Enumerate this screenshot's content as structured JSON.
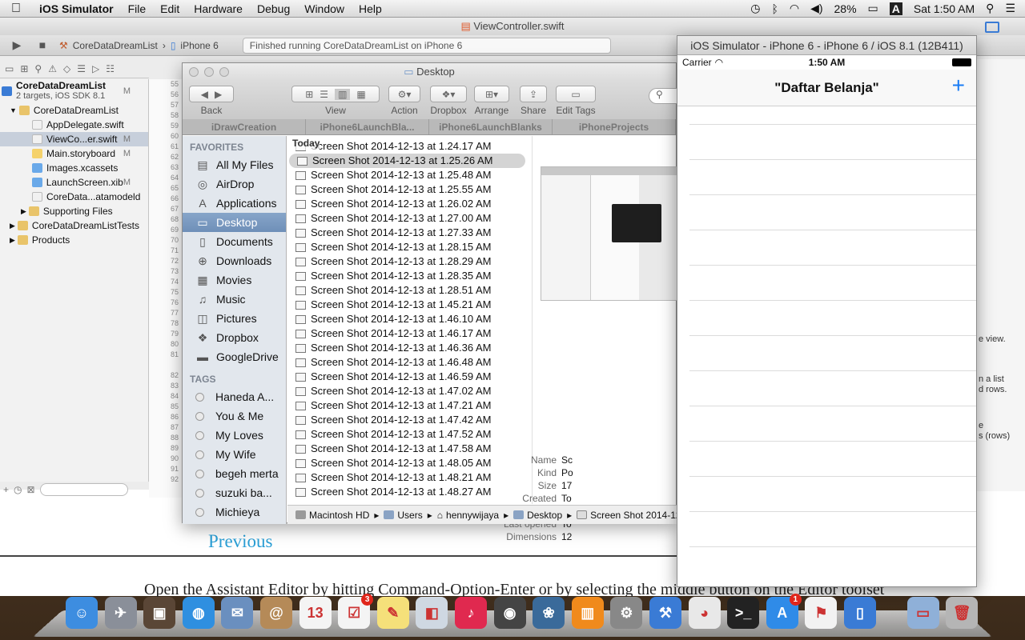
{
  "menubar": {
    "app_name": "iOS Simulator",
    "items": [
      "File",
      "Edit",
      "Hardware",
      "Debug",
      "Window",
      "Help"
    ],
    "battery": "28%",
    "input_source": "A",
    "clock": "Sat 1:50 AM"
  },
  "background_page": {
    "previous_link": "Previous",
    "instruction": "Open the Assistant Editor by hitting Command-Option-Enter or by selecting the middle button on the Editor toolset"
  },
  "xcode": {
    "title": "ViewController.swift",
    "scheme_project": "CoreDataDreamList",
    "scheme_device": "iPhone 6",
    "activity": "Finished running CoreDataDreamList on iPhone 6",
    "navigator": [
      {
        "label": "CoreDataDreamList",
        "sub": "2 targets, iOS SDK 8.1",
        "status": "M",
        "level": 0,
        "type": "project"
      },
      {
        "label": "CoreDataDreamList",
        "status": "",
        "level": 1,
        "type": "folder"
      },
      {
        "label": "AppDelegate.swift",
        "status": "",
        "level": 2,
        "type": "swift"
      },
      {
        "label": "ViewCo...er.swift",
        "status": "M",
        "level": 2,
        "type": "swift",
        "selected": true
      },
      {
        "label": "Main.storyboard",
        "status": "M",
        "level": 2,
        "type": "storyboard"
      },
      {
        "label": "Images.xcassets",
        "status": "",
        "level": 2,
        "type": "assets"
      },
      {
        "label": "LaunchScreen.xib",
        "status": "M",
        "level": 2,
        "type": "xib"
      },
      {
        "label": "CoreData...atamodeld",
        "status": "",
        "level": 2,
        "type": "model"
      },
      {
        "label": "Supporting Files",
        "status": "",
        "level": 2,
        "type": "folder"
      },
      {
        "label": "CoreDataDreamListTests",
        "status": "",
        "level": 1,
        "type": "folder"
      },
      {
        "label": "Products",
        "status": "",
        "level": 1,
        "type": "folder"
      }
    ],
    "line_numbers": [
      "55",
      "56",
      "57",
      "58",
      "59",
      "60",
      "61",
      "62",
      "63",
      "64",
      "65",
      "66",
      "67",
      "68",
      "69",
      "70",
      "71",
      "72",
      "73",
      "74",
      "75",
      "76",
      "77",
      "78",
      "79",
      "80",
      "81",
      "",
      "82",
      "83",
      "84",
      "85",
      "86",
      "87",
      "88",
      "89",
      "90",
      "91",
      "92"
    ],
    "right_snippets": [
      "e view.",
      "n a list",
      "d rows.",
      "e",
      "s (rows)"
    ]
  },
  "finder": {
    "title": "Desktop",
    "toolbar": {
      "back": "Back",
      "view": "View",
      "action": "Action",
      "dropbox": "Dropbox",
      "arrange": "Arrange",
      "share": "Share",
      "edit_tags": "Edit Tags"
    },
    "tabs": [
      "iDrawCreation",
      "iPhone6LaunchBla...",
      "iPhone6LaunchBlanks",
      "iPhoneProjects"
    ],
    "favorites_header": "FAVORITES",
    "favorites": [
      {
        "label": "All My Files",
        "icon": "all-files-icon",
        "glyph": "▤"
      },
      {
        "label": "AirDrop",
        "icon": "airdrop-icon",
        "glyph": "◎"
      },
      {
        "label": "Applications",
        "icon": "applications-icon",
        "glyph": "A"
      },
      {
        "label": "Desktop",
        "icon": "desktop-icon",
        "glyph": "▭",
        "selected": true
      },
      {
        "label": "Documents",
        "icon": "documents-icon",
        "glyph": "▯"
      },
      {
        "label": "Downloads",
        "icon": "downloads-icon",
        "glyph": "⊕"
      },
      {
        "label": "Movies",
        "icon": "movies-icon",
        "glyph": "▦"
      },
      {
        "label": "Music",
        "icon": "music-icon",
        "glyph": "♫"
      },
      {
        "label": "Pictures",
        "icon": "pictures-icon",
        "glyph": "◫"
      },
      {
        "label": "Dropbox",
        "icon": "dropbox-icon",
        "glyph": "❖"
      },
      {
        "label": "GoogleDrive",
        "icon": "folder-icon",
        "glyph": "▬"
      }
    ],
    "tags_header": "TAGS",
    "tags": [
      "Haneda A...",
      "You & Me",
      "My Loves",
      "My Wife",
      "begeh merta",
      "suzuki ba...",
      "Michieya"
    ],
    "list_header": "Today",
    "files": [
      "Screen Shot 2014-12-13 at 1.24.17 AM",
      "Screen Shot 2014-12-13 at 1.25.26 AM",
      "Screen Shot 2014-12-13 at 1.25.48 AM",
      "Screen Shot 2014-12-13 at 1.25.55 AM",
      "Screen Shot 2014-12-13 at 1.26.02 AM",
      "Screen Shot 2014-12-13 at 1.27.00 AM",
      "Screen Shot 2014-12-13 at 1.27.33 AM",
      "Screen Shot 2014-12-13 at 1.28.15 AM",
      "Screen Shot 2014-12-13 at 1.28.29 AM",
      "Screen Shot 2014-12-13 at 1.28.35 AM",
      "Screen Shot 2014-12-13 at 1.28.51 AM",
      "Screen Shot 2014-12-13 at 1.45.21 AM",
      "Screen Shot 2014-12-13 at 1.46.10 AM",
      "Screen Shot 2014-12-13 at 1.46.17 AM",
      "Screen Shot 2014-12-13 at 1.46.36 AM",
      "Screen Shot 2014-12-13 at 1.46.48 AM",
      "Screen Shot 2014-12-13 at 1.46.59 AM",
      "Screen Shot 2014-12-13 at 1.47.02 AM",
      "Screen Shot 2014-12-13 at 1.47.21 AM",
      "Screen Shot 2014-12-13 at 1.47.42 AM",
      "Screen Shot 2014-12-13 at 1.47.52 AM",
      "Screen Shot 2014-12-13 at 1.47.58 AM",
      "Screen Shot 2014-12-13 at 1.48.05 AM",
      "Screen Shot 2014-12-13 at 1.48.21 AM",
      "Screen Shot 2014-12-13 at 1.48.27 AM"
    ],
    "selected_file_index": 1,
    "preview_meta": [
      {
        "key": "Name",
        "value": "Sc"
      },
      {
        "key": "Kind",
        "value": "Po"
      },
      {
        "key": "Size",
        "value": "17"
      },
      {
        "key": "Created",
        "value": "To"
      },
      {
        "key": "Modified",
        "value": "To"
      },
      {
        "key": "Last opened",
        "value": "To"
      },
      {
        "key": "Dimensions",
        "value": "12"
      }
    ],
    "path": [
      "Macintosh HD",
      "Users",
      "hennywijaya",
      "Desktop",
      "Screen Shot 2014-12"
    ]
  },
  "simulator": {
    "title": "iOS Simulator - iPhone 6 - iPhone 6 / iOS 8.1 (12B411)",
    "carrier": "Carrier",
    "time": "1:50 AM",
    "nav_title": "\"Daftar Belanja\"",
    "add_button": "+",
    "row_count": 13
  },
  "dock": {
    "items": [
      {
        "name": "finder",
        "color": "#3d8de0",
        "glyph": "☺"
      },
      {
        "name": "launchpad",
        "color": "#8a8f99",
        "glyph": "✈"
      },
      {
        "name": "photo-booth",
        "color": "#5a4636",
        "glyph": "▣"
      },
      {
        "name": "safari",
        "color": "#2f8fe0",
        "glyph": "◍"
      },
      {
        "name": "mail",
        "color": "#6a8fbf",
        "glyph": "✉"
      },
      {
        "name": "contacts",
        "color": "#b58a58",
        "glyph": "@"
      },
      {
        "name": "calendar",
        "color": "#f4f4f4",
        "glyph": "13"
      },
      {
        "name": "reminders",
        "color": "#f4f4f4",
        "glyph": "☑",
        "badge": "3"
      },
      {
        "name": "notes",
        "color": "#f5e07a",
        "glyph": "✎"
      },
      {
        "name": "preview",
        "color": "#cfd8e2",
        "glyph": "◧"
      },
      {
        "name": "itunes",
        "color": "#e0294f",
        "glyph": "♪"
      },
      {
        "name": "facetime",
        "color": "#444",
        "glyph": "◉"
      },
      {
        "name": "iphoto",
        "color": "#3a6a9a",
        "glyph": "❀"
      },
      {
        "name": "ibooks",
        "color": "#f08a1c",
        "glyph": "▥"
      },
      {
        "name": "system-preferences",
        "color": "#888",
        "glyph": "⚙"
      },
      {
        "name": "xcode",
        "color": "#3a7bd5",
        "glyph": "⚒"
      },
      {
        "name": "chrome",
        "color": "#e8e8e8",
        "glyph": "◕"
      },
      {
        "name": "terminal",
        "color": "#222",
        "glyph": ">_"
      },
      {
        "name": "app-store",
        "color": "#2f8be8",
        "glyph": "A",
        "badge": "1"
      },
      {
        "name": "acrobat",
        "color": "#f2f2f2",
        "glyph": "⚑"
      },
      {
        "name": "ios-simulator",
        "color": "#3a7bd5",
        "glyph": "▯"
      },
      {
        "name": "applications-folder",
        "color": "#8fb0d8",
        "glyph": "▭"
      },
      {
        "name": "trash",
        "color": "#b5b5b5",
        "glyph": "🗑"
      }
    ]
  }
}
